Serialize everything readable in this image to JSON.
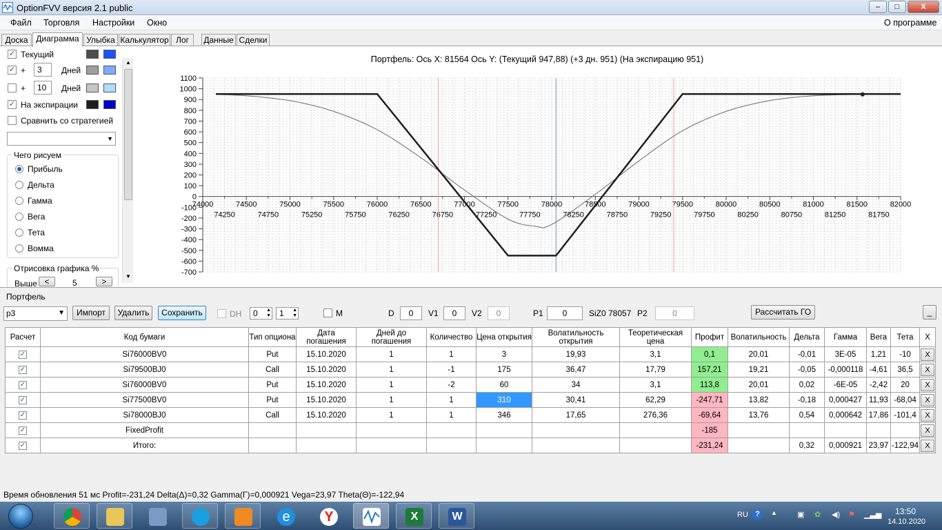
{
  "window": {
    "title": "OptionFVV версия 2.1 public",
    "min": "–",
    "max": "□",
    "close": "X"
  },
  "menu": {
    "items": [
      "Файл",
      "Торговля",
      "Настройки",
      "Окно"
    ],
    "about": "О программе"
  },
  "tabs": [
    "Доска",
    "Диаграмма",
    "Улыбка",
    "Калькулятор",
    "Лог",
    "Данные",
    "Сделки"
  ],
  "left": {
    "current": {
      "label": "Текущий",
      "checked": "✓",
      "color1": "#4d4d4d",
      "color2": "#1a53ff"
    },
    "row1": {
      "checked": "✓",
      "plus": "+",
      "days": "3",
      "days_label": "Дней",
      "color1": "#9e9e9e",
      "color2": "#80aaff"
    },
    "row2": {
      "checked": "",
      "plus": "+",
      "days": "10",
      "days_label": "Дней",
      "color1": "#c6c6c6",
      "color2": "#b0dcff"
    },
    "expiry": {
      "label": "На экспирации",
      "checked": "✓",
      "color1": "#1e1e1e",
      "color2": "#0000cc"
    },
    "compare": {
      "label": "Сравнить со стратегией",
      "checked": ""
    },
    "what_title": "Чего рисуем",
    "radios": [
      "Прибыль",
      "Дельта",
      "Гамма",
      "Вега",
      "Тета",
      "Вомма"
    ],
    "draw_title": "Отрисовка графика %",
    "height_label": "Выше",
    "dec": "<",
    "inc": ">",
    "pct": "5"
  },
  "chart_data": {
    "type": "line",
    "title": "Портфель:  Ось X:  81564  Ось Y:   (Текущий 947,88)   (+3 дн. 951)   (На экспирацию 951)",
    "xlim": [
      74000,
      82000
    ],
    "ylim": [
      -700,
      1100
    ],
    "x_ticks_upper": [
      74000,
      74500,
      75000,
      75500,
      76000,
      76500,
      77000,
      77500,
      78000,
      78500,
      79000,
      79500,
      80000,
      80500,
      81000,
      81500,
      82000
    ],
    "x_ticks_lower": [
      74250,
      74750,
      75250,
      75750,
      76250,
      76750,
      77250,
      77750,
      78250,
      78750,
      79250,
      79750,
      80250,
      80750,
      81250,
      81750
    ],
    "y_ticks": [
      1100,
      1000,
      900,
      800,
      700,
      600,
      500,
      400,
      300,
      200,
      100,
      0,
      -100,
      -200,
      -300,
      -400,
      -500,
      -600,
      -700
    ],
    "grid": true,
    "series": [
      {
        "color": "#1e1e1e",
        "width": 2.5,
        "x": [
          74150,
          76000,
          77500,
          78050,
          79500,
          82000
        ],
        "y": [
          951,
          951,
          -549,
          -549,
          951,
          951
        ]
      },
      {
        "color": "#6b6b6b",
        "width": 1,
        "x": [
          74150,
          74500,
          75000,
          75500,
          76000,
          76500,
          77000,
          77500,
          77800,
          78000,
          78500,
          79000,
          79500,
          80000,
          80500,
          81000,
          81500,
          82000
        ],
        "y": [
          947,
          935,
          890,
          790,
          620,
          360,
          60,
          -210,
          -275,
          -260,
          20,
          330,
          610,
          790,
          890,
          935,
          947,
          951
        ]
      }
    ],
    "vlines": [
      {
        "x": 76700,
        "color": "#f0a0a8"
      },
      {
        "x": 79400,
        "color": "#f0a0a8"
      },
      {
        "x": 78050,
        "color": "#7a90a8"
      }
    ],
    "marker": {
      "x": 81564,
      "y": 947.88
    }
  },
  "portfolio": {
    "group_title": "Портфель",
    "name": "p3",
    "import": "Импорт",
    "delete": "Удалить",
    "save": "Сохранить",
    "dh": "DH",
    "s1": "0",
    "s2": "1",
    "m": "M",
    "d_label": "D",
    "d": "0",
    "v1_label": "V1",
    "v1": "0",
    "v2_label": "V2",
    "v2": "0",
    "p1_label": "P1",
    "p1": "0",
    "fut": "SiZ0 78057",
    "p2_label": "P2",
    "p2": "0",
    "calc_go": "Рассчитать ГО",
    "minimize": "_",
    "headers": [
      "Расчет",
      "Код бумаги",
      "Тип опциона",
      "Дата погашения",
      "Дней до погашения",
      "Количество",
      "Цена открытия",
      "Волатильность открытия",
      "Теоретическая цена",
      "Профит",
      "Волатильность",
      "Дельта",
      "Гамма",
      "Вега",
      "Тета",
      "X"
    ],
    "rows": [
      [
        "✓",
        "Si76000BV0",
        "Put",
        "15.10.2020",
        "1",
        "1",
        "3",
        "19,93",
        "3,1",
        "0,1",
        "20,01",
        "-0,01",
        "3E-05",
        "1,21",
        "-10",
        "X"
      ],
      [
        "✓",
        "Si79500BJ0",
        "Call",
        "15.10.2020",
        "1",
        "-1",
        "175",
        "36,47",
        "17,79",
        "157,21",
        "19,21",
        "-0,05",
        "-0,000118",
        "-4,61",
        "36,5",
        "X"
      ],
      [
        "✓",
        "Si76000BV0",
        "Put",
        "15.10.2020",
        "1",
        "-2",
        "60",
        "34",
        "3,1",
        "113,8",
        "20,01",
        "0,02",
        "-6E-05",
        "-2,42",
        "20",
        "X"
      ],
      [
        "✓",
        "Si77500BV0",
        "Put",
        "15.10.2020",
        "1",
        "1",
        "310",
        "30,41",
        "62,29",
        "-247,71",
        "13,82",
        "-0,18",
        "0,000427",
        "11,93",
        "-68,04",
        "X"
      ],
      [
        "✓",
        "Si78000BJ0",
        "Call",
        "15.10.2020",
        "1",
        "1",
        "346",
        "17,65",
        "276,36",
        "-69,64",
        "13,76",
        "0,54",
        "0,000642",
        "17,86",
        "-101,4",
        "X"
      ],
      [
        "✓",
        "FixedProfit",
        "",
        "",
        "",
        "",
        "",
        "",
        "",
        "-185",
        "",
        "",
        "",
        "",
        "",
        "X"
      ],
      [
        "✓",
        "Итого:",
        "",
        "",
        "",
        "",
        "",
        "",
        "",
        "-231,24",
        "",
        "0,32",
        "0,000921",
        "23,97",
        "-122,94",
        "X"
      ]
    ]
  },
  "status": "Время обновления 51 мс  Profit=-231,24 Delta(Δ)=0,32 Gamma(Γ)=0,000921 Vega=23,97 Theta(Θ)=-122,94",
  "taskbar": {
    "lang": "RU",
    "time": "13:50",
    "date": "14.10.2020"
  }
}
